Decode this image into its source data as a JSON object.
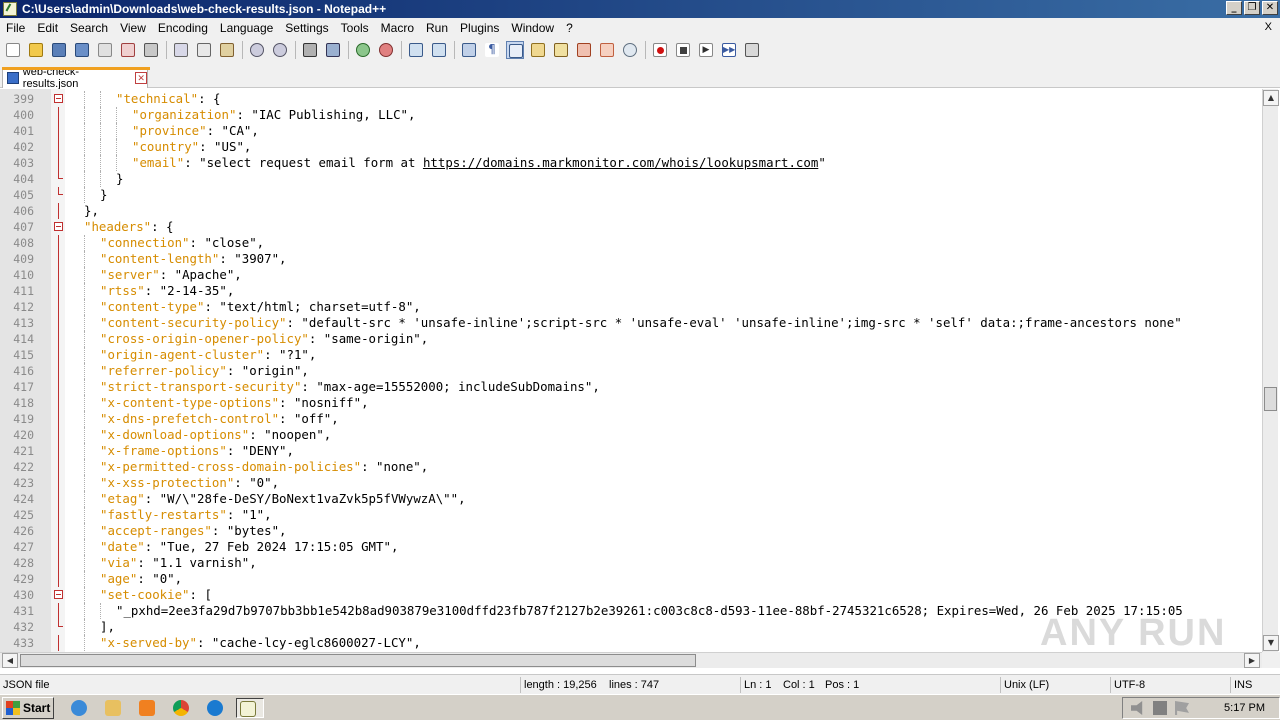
{
  "window": {
    "title": "C:\\Users\\admin\\Downloads\\web-check-results.json - Notepad++",
    "minimize": "_",
    "restore": "❐",
    "close": "✕"
  },
  "menu": [
    "File",
    "Edit",
    "Search",
    "View",
    "Encoding",
    "Language",
    "Settings",
    "Tools",
    "Macro",
    "Run",
    "Plugins",
    "Window",
    "?"
  ],
  "menu_close": "X",
  "toolbar": {
    "icons": [
      "new-file",
      "open-file",
      "save",
      "save-all",
      "close",
      "close-all",
      "print",
      "cut",
      "copy",
      "paste",
      "undo",
      "redo",
      "find",
      "replace",
      "zoom-in",
      "zoom-out",
      "sync-vertical",
      "sync-horizontal",
      "word-wrap",
      "show-all-chars",
      "indent-guide",
      "user-defined-language",
      "doc-map",
      "function-list",
      "folder-as-workspace",
      "monitoring",
      "record-macro",
      "stop-record",
      "playback-macro",
      "run-macro-multiple",
      "save-macro"
    ]
  },
  "tab": {
    "label": "web-check-results.json",
    "close": "✕"
  },
  "editor": {
    "lines": [
      {
        "n": "399",
        "indent": 3,
        "key": "\"technical\"",
        "rest": ": {",
        "fold": "open"
      },
      {
        "n": "400",
        "indent": 4,
        "key": "\"organization\"",
        "rest": ": \"IAC Publishing, LLC\","
      },
      {
        "n": "401",
        "indent": 4,
        "key": "\"province\"",
        "rest": ": \"CA\","
      },
      {
        "n": "402",
        "indent": 4,
        "key": "\"country\"",
        "rest": ": \"US\","
      },
      {
        "n": "403",
        "indent": 4,
        "key": "\"email\"",
        "rest": ": \"select request email form at ",
        "url": "https://domains.markmonitor.com/whois/lookupsmart.com",
        "tail": "\""
      },
      {
        "n": "404",
        "indent": 3,
        "key": "",
        "rest": "}",
        "fold": "end"
      },
      {
        "n": "405",
        "indent": 2,
        "key": "",
        "rest": "}",
        "fold": "end"
      },
      {
        "n": "406",
        "indent": 1,
        "key": "",
        "rest": "},",
        "fold": "line"
      },
      {
        "n": "407",
        "indent": 1,
        "key": "\"headers\"",
        "rest": ": {",
        "fold": "open"
      },
      {
        "n": "408",
        "indent": 2,
        "key": "\"connection\"",
        "rest": ": \"close\","
      },
      {
        "n": "409",
        "indent": 2,
        "key": "\"content-length\"",
        "rest": ": \"3907\","
      },
      {
        "n": "410",
        "indent": 2,
        "key": "\"server\"",
        "rest": ": \"Apache\","
      },
      {
        "n": "411",
        "indent": 2,
        "key": "\"rtss\"",
        "rest": ": \"2-14-35\","
      },
      {
        "n": "412",
        "indent": 2,
        "key": "\"content-type\"",
        "rest": ": \"text/html; charset=utf-8\","
      },
      {
        "n": "413",
        "indent": 2,
        "key": "\"content-security-policy\"",
        "rest": ": \"default-src * 'unsafe-inline';script-src * 'unsafe-eval' 'unsafe-inline';img-src * 'self' data:;frame-ancestors none\""
      },
      {
        "n": "414",
        "indent": 2,
        "key": "\"cross-origin-opener-policy\"",
        "rest": ": \"same-origin\","
      },
      {
        "n": "415",
        "indent": 2,
        "key": "\"origin-agent-cluster\"",
        "rest": ": \"?1\","
      },
      {
        "n": "416",
        "indent": 2,
        "key": "\"referrer-policy\"",
        "rest": ": \"origin\","
      },
      {
        "n": "417",
        "indent": 2,
        "key": "\"strict-transport-security\"",
        "rest": ": \"max-age=15552000; includeSubDomains\","
      },
      {
        "n": "418",
        "indent": 2,
        "key": "\"x-content-type-options\"",
        "rest": ": \"nosniff\","
      },
      {
        "n": "419",
        "indent": 2,
        "key": "\"x-dns-prefetch-control\"",
        "rest": ": \"off\","
      },
      {
        "n": "420",
        "indent": 2,
        "key": "\"x-download-options\"",
        "rest": ": \"noopen\","
      },
      {
        "n": "421",
        "indent": 2,
        "key": "\"x-frame-options\"",
        "rest": ": \"DENY\","
      },
      {
        "n": "422",
        "indent": 2,
        "key": "\"x-permitted-cross-domain-policies\"",
        "rest": ": \"none\","
      },
      {
        "n": "423",
        "indent": 2,
        "key": "\"x-xss-protection\"",
        "rest": ": \"0\","
      },
      {
        "n": "424",
        "indent": 2,
        "key": "\"etag\"",
        "rest": ": \"W/\\\"28fe-DeSY/BoNext1vaZvk5p5fVWywzA\\\"\","
      },
      {
        "n": "425",
        "indent": 2,
        "key": "\"fastly-restarts\"",
        "rest": ": \"1\","
      },
      {
        "n": "426",
        "indent": 2,
        "key": "\"accept-ranges\"",
        "rest": ": \"bytes\","
      },
      {
        "n": "427",
        "indent": 2,
        "key": "\"date\"",
        "rest": ": \"Tue, 27 Feb 2024 17:15:05 GMT\","
      },
      {
        "n": "428",
        "indent": 2,
        "key": "\"via\"",
        "rest": ": \"1.1 varnish\","
      },
      {
        "n": "429",
        "indent": 2,
        "key": "\"age\"",
        "rest": ": \"0\","
      },
      {
        "n": "430",
        "indent": 2,
        "key": "\"set-cookie\"",
        "rest": ": [",
        "fold": "open"
      },
      {
        "n": "431",
        "indent": 3,
        "key": "",
        "rest": "\"_pxhd=2ee3fa29d7b9707bb3bb1e542b8ad903879e3100dffd23fb787f2127b2e39261:c003c8c8-d593-11ee-88bf-2745321c6528; Expires=Wed, 26 Feb 2025 17:15:05"
      },
      {
        "n": "432",
        "indent": 2,
        "key": "",
        "rest": "],",
        "fold": "end"
      },
      {
        "n": "433",
        "indent": 2,
        "key": "\"x-served-by\"",
        "rest": ": \"cache-lcy-eglc8600027-LCY\","
      }
    ]
  },
  "watermark": "ANY RUN",
  "status": {
    "filetype": "JSON file",
    "length": "length : 19,256",
    "lines": "lines : 747",
    "ln": "Ln : 1",
    "col": "Col : 1",
    "pos": "Pos : 1",
    "eol": "Unix (LF)",
    "encoding": "UTF-8",
    "mode": "INS"
  },
  "taskbar": {
    "start": "Start",
    "clock": "5:17 PM",
    "apps": [
      "internet-explorer",
      "file-explorer",
      "media-player",
      "chrome",
      "edge",
      "notepad-plus-plus"
    ]
  },
  "colors": {
    "key": "#d68c00",
    "fold_marker": "#c03030",
    "titlebar": "#0a246a"
  }
}
